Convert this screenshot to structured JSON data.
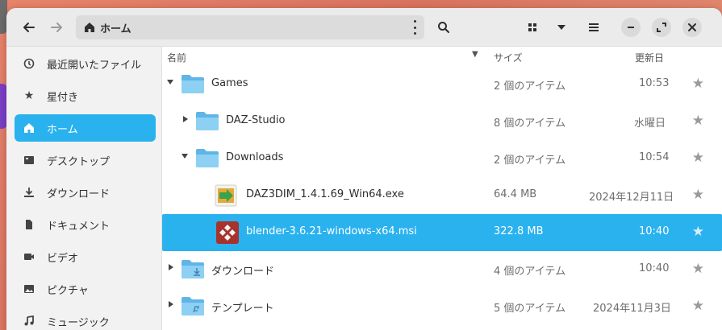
{
  "window": {
    "path_label": "ホーム"
  },
  "sidebar": {
    "items": [
      {
        "label": "最近開いたファイル",
        "icon": "clock-icon"
      },
      {
        "label": "星付き",
        "icon": "star-icon"
      },
      {
        "label": "ホーム",
        "icon": "home-icon",
        "active": true
      },
      {
        "label": "デスクトップ",
        "icon": "desktop-icon"
      },
      {
        "label": "ダウンロード",
        "icon": "download-icon"
      },
      {
        "label": "ドキュメント",
        "icon": "document-icon"
      },
      {
        "label": "ビデオ",
        "icon": "video-icon"
      },
      {
        "label": "ピクチャ",
        "icon": "picture-icon"
      },
      {
        "label": "ミュージック",
        "icon": "music-icon"
      }
    ]
  },
  "columns": {
    "name": "名前",
    "size": "サイズ",
    "modified": "更新日"
  },
  "files": [
    {
      "name": "Games",
      "size": "2 個のアイテム",
      "modified": "10:53",
      "type": "folder",
      "expanded": true
    },
    {
      "name": "DAZ-Studio",
      "size": "8 個のアイテム",
      "modified": "水曜日",
      "type": "folder",
      "expanded": false
    },
    {
      "name": "Downloads",
      "size": "2 個のアイテム",
      "modified": "10:54",
      "type": "folder",
      "expanded": true
    },
    {
      "name": "DAZ3DIM_1.4.1.69_Win64.exe",
      "size": "64.4 MB",
      "modified": "2024年12月11日",
      "type": "exe"
    },
    {
      "name": "blender-3.6.21-windows-x64.msi",
      "size": "322.8 MB",
      "modified": "10:40",
      "type": "msi",
      "selected": true
    },
    {
      "name": "ダウンロード",
      "size": "4 個のアイテム",
      "modified": "10:40",
      "type": "folder-download",
      "expanded": false
    },
    {
      "name": "テンプレート",
      "size": "5 個のアイテム",
      "modified": "2024年11月3日",
      "type": "folder-template",
      "expanded": false
    }
  ],
  "colors": {
    "accent": "#2ab2ef",
    "folder": "#7fc8f0",
    "background": "#e8836b"
  }
}
